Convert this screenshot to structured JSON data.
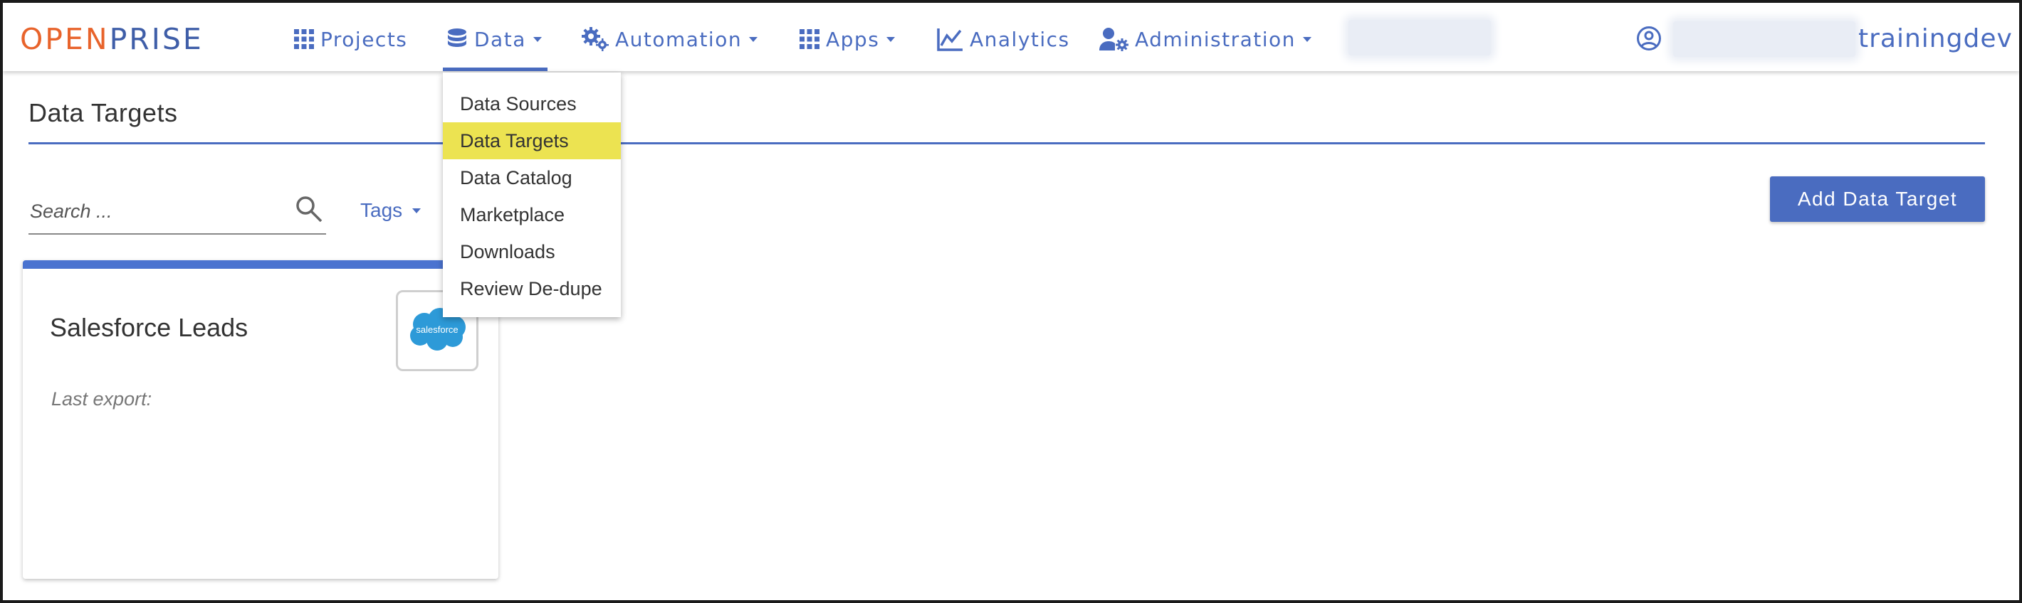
{
  "brand": {
    "logo_open": "OPEN",
    "logo_prise": "PRISE",
    "color_open": "#e8632b",
    "color_prise": "#3f5ea8"
  },
  "nav": {
    "items": [
      {
        "label": "Projects",
        "icon": "grid-icon"
      },
      {
        "label": "Data",
        "icon": "database-icon"
      },
      {
        "label": "Automation",
        "icon": "gears-icon"
      },
      {
        "label": "Apps",
        "icon": "grid-icon"
      },
      {
        "label": "Analytics",
        "icon": "chart-line-icon"
      },
      {
        "label": "Administration",
        "icon": "user-gear-icon"
      }
    ],
    "active": "Data",
    "accent": "#4a6cc0"
  },
  "user": {
    "icon": "user-circle-icon",
    "name": "trainingdev"
  },
  "data_menu": {
    "items": [
      "Data Sources",
      "Data Targets",
      "Data Catalog",
      "Marketplace",
      "Downloads",
      "Review De-dupe"
    ],
    "highlighted": "Data Targets",
    "highlight_color": "#ece351"
  },
  "page": {
    "title": "Data Targets",
    "search_placeholder": "Search ...",
    "tags_label": "Tags",
    "add_button": "Add Data Target"
  },
  "cards": [
    {
      "title": "Salesforce Leads",
      "subtitle": "Last export:",
      "logo_text": "salesforce",
      "logo_color": "#2d9ad8"
    }
  ]
}
